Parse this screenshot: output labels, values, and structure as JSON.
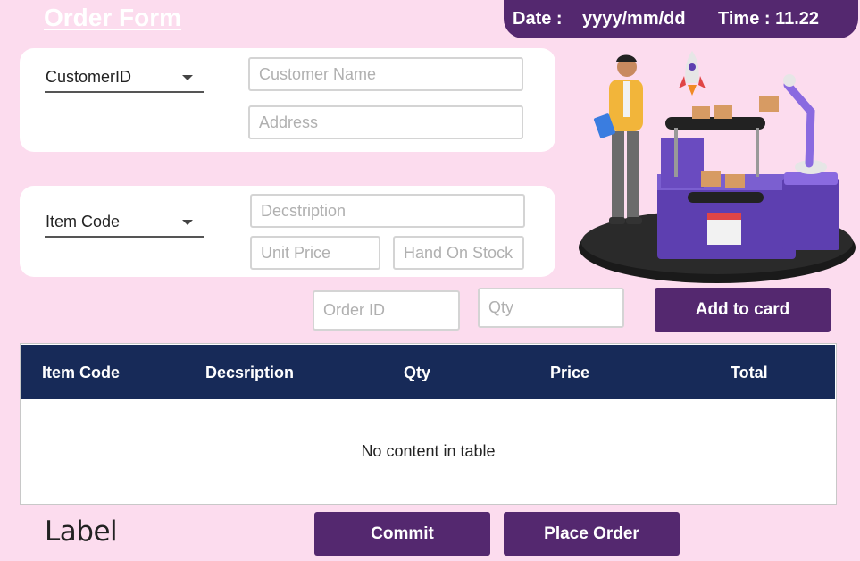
{
  "header": {
    "title": "Order Form",
    "date_label": "Date :",
    "date_value": "yyyy/mm/dd",
    "time_label": "Time : 11.22"
  },
  "customer": {
    "combo_label": "CustomerID",
    "name_placeholder": "Customer Name",
    "address_placeholder": "Address"
  },
  "item": {
    "combo_label": "Item Code",
    "description_placeholder": "Decstription",
    "unit_price_placeholder": "Unit Price",
    "stock_placeholder": "Hand On Stock"
  },
  "order": {
    "order_id_placeholder": "Order ID",
    "qty_placeholder": "Qty",
    "add_button": "Add to card"
  },
  "table": {
    "columns": [
      "Item Code",
      "Decsription",
      "Qty",
      "Price",
      "Total"
    ],
    "empty_text": "No content in table"
  },
  "footer": {
    "label": "Label",
    "commit_button": "Commit",
    "place_order_button": "Place Order"
  },
  "colors": {
    "background": "#fcdcee",
    "accent": "#54286f",
    "table_header": "#172a58"
  },
  "illustration": "warehouse-conveyor-illustration"
}
